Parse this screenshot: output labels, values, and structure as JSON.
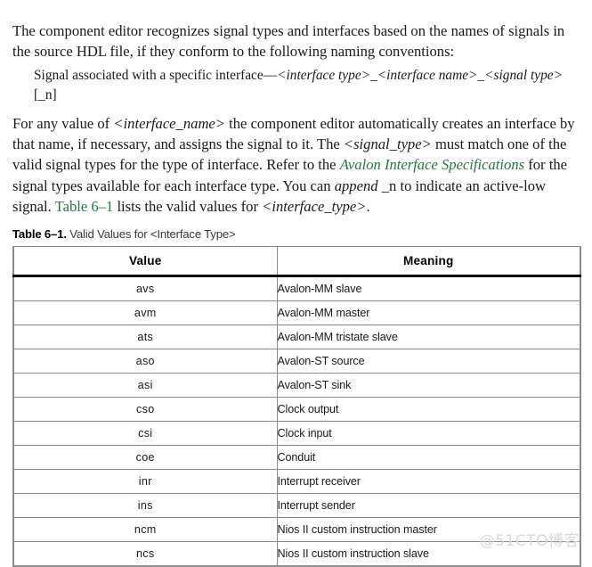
{
  "document": {
    "paragraphs": {
      "intro": "The component editor recognizes signal types and interfaces based on the names of signals in the source HDL file, if they conform to the following naming conventions:",
      "signal_rule_prefix": "Signal associated with a specific interface—",
      "signal_rule_italic_1": "<interface type>",
      "signal_rule_sep_1": "_",
      "signal_rule_italic_2": "<interface name>",
      "signal_rule_sep_2": "_",
      "signal_rule_italic_3": "<signal type>",
      "signal_rule_suffix": "[_n]",
      "anyvalue_1": "For any value of ",
      "anyvalue_it_1": "<interface_name>",
      "anyvalue_2": " the component editor automatically creates an interface by that name, if necessary, and assigns the signal to it. The ",
      "anyvalue_it_2": "<signal_type>",
      "anyvalue_3": " must match one of the valid signal types for the type of interface. Refer to the ",
      "anyvalue_link_1": "Avalon Interface Specifications",
      "anyvalue_4": " for the signal types available for each interface type. You can ",
      "anyvalue_it_3": "append",
      "anyvalue_5": " _n to indicate an active-low signal. ",
      "anyvalue_link_2": "Table 6–1",
      "anyvalue_6": " lists the valid values for ",
      "anyvalue_it_4": "<interface_type>",
      "anyvalue_7": "."
    },
    "table": {
      "caption_label": "Table 6–1.",
      "caption_text": "Valid Values for <Interface Type>",
      "columns": [
        "Value",
        "Meaning"
      ],
      "rows": [
        {
          "value": "avs",
          "meaning": "Avalon-MM slave"
        },
        {
          "value": "avm",
          "meaning": "Avalon-MM master"
        },
        {
          "value": "ats",
          "meaning": "Avalon-MM tristate slave"
        },
        {
          "value": "aso",
          "meaning": "Avalon-ST source"
        },
        {
          "value": "asi",
          "meaning": "Avalon-ST sink"
        },
        {
          "value": "cso",
          "meaning": "Clock output"
        },
        {
          "value": "csi",
          "meaning": "Clock input"
        },
        {
          "value": "coe",
          "meaning": "Conduit"
        },
        {
          "value": "inr",
          "meaning": "Interrupt receiver"
        },
        {
          "value": "ins",
          "meaning": "Interrupt sender"
        },
        {
          "value": "ncm",
          "meaning": "Nios II custom instruction master"
        },
        {
          "value": "ncs",
          "meaning": "Nios II custom instruction slave"
        }
      ]
    },
    "watermark": "@51CTO博客",
    "colors": {
      "link_green": "#1f7a3d",
      "table_border_gray": "#8c8c8c",
      "header_rule_black": "#000000",
      "watermark_gray": "#d9d9d9"
    }
  }
}
